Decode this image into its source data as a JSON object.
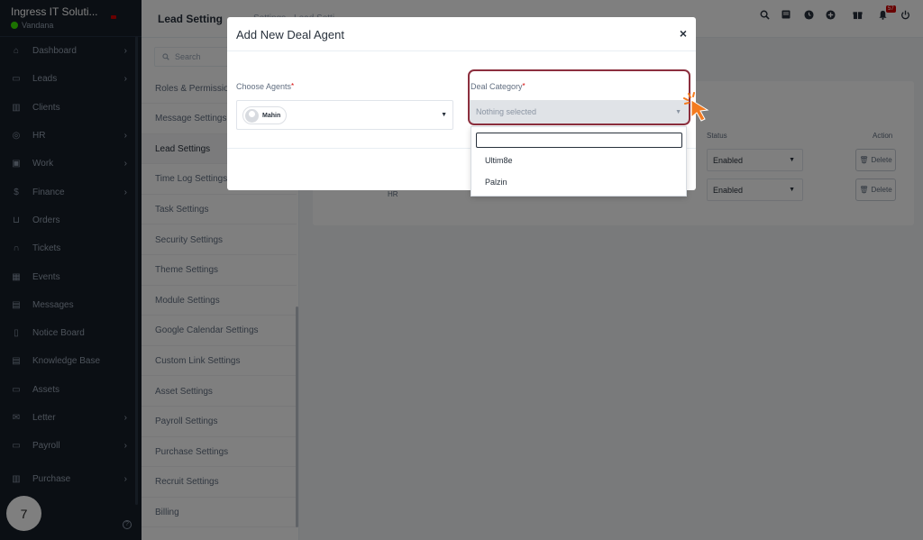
{
  "sidebar": {
    "brand_name": "Ingress IT Soluti...",
    "user_name": "Vandana",
    "items": [
      {
        "label": "Dashboard",
        "icon": "home-icon",
        "chevron": true
      },
      {
        "label": "Leads",
        "icon": "id-card-icon",
        "chevron": true
      },
      {
        "label": "Clients",
        "icon": "chart-icon",
        "chevron": false
      },
      {
        "label": "HR",
        "icon": "people-icon",
        "chevron": true
      },
      {
        "label": "Work",
        "icon": "briefcase-icon",
        "chevron": true
      },
      {
        "label": "Finance",
        "icon": "dollar-icon",
        "chevron": true
      },
      {
        "label": "Orders",
        "icon": "cart-icon",
        "chevron": false
      },
      {
        "label": "Tickets",
        "icon": "headset-icon",
        "chevron": false
      },
      {
        "label": "Events",
        "icon": "calendar-icon",
        "chevron": false
      },
      {
        "label": "Messages",
        "icon": "chat-icon",
        "chevron": false
      },
      {
        "label": "Notice Board",
        "icon": "clipboard-icon",
        "chevron": false
      },
      {
        "label": "Knowledge Base",
        "icon": "document-icon",
        "chevron": false
      },
      {
        "label": "Assets",
        "icon": "monitor-icon",
        "chevron": false
      },
      {
        "label": "Letter",
        "icon": "mail-icon",
        "chevron": true
      },
      {
        "label": "Payroll",
        "icon": "wallet-icon",
        "chevron": true
      },
      {
        "label": "Purchase",
        "icon": "receipt-icon",
        "chevron": true
      }
    ],
    "step_number": "7",
    "help": "?"
  },
  "header": {
    "title": "Lead Setting",
    "breadcrumb_rest": "Settings · Lead Setti",
    "notification_count": "57"
  },
  "settings_menu": {
    "search_placeholder": "Search",
    "items": [
      "Roles & Permissions",
      "Message Settings",
      "Lead Settings",
      "Time Log Settings",
      "Task Settings",
      "Security Settings",
      "Theme Settings",
      "Module Settings",
      "Google Calendar Settings",
      "Custom Link Settings",
      "Asset Settings",
      "Payroll Settings",
      "Purchase Settings",
      "Recruit Settings",
      "Billing"
    ],
    "active_index": 2
  },
  "table": {
    "status_header": "Status",
    "action_header": "Action",
    "rows": [
      {
        "status": "Enabled",
        "action": "Delete"
      },
      {
        "status": "Enabled",
        "action": "Delete",
        "extra": "HR"
      }
    ]
  },
  "modal": {
    "title": "Add New Deal Agent",
    "close_label": "×",
    "agents_label": "Choose Agents",
    "agents_selected": "Mahin",
    "category_label": "Deal Category",
    "category_placeholder": "Nothing selected",
    "required_mark": "*",
    "options": [
      "Ultim8e",
      "Palzin"
    ]
  },
  "colors": {
    "sidebar_bg": "#171f29",
    "highlight_border": "#8c2f3e",
    "required": "#d30000",
    "cursor": "#f47b20"
  }
}
